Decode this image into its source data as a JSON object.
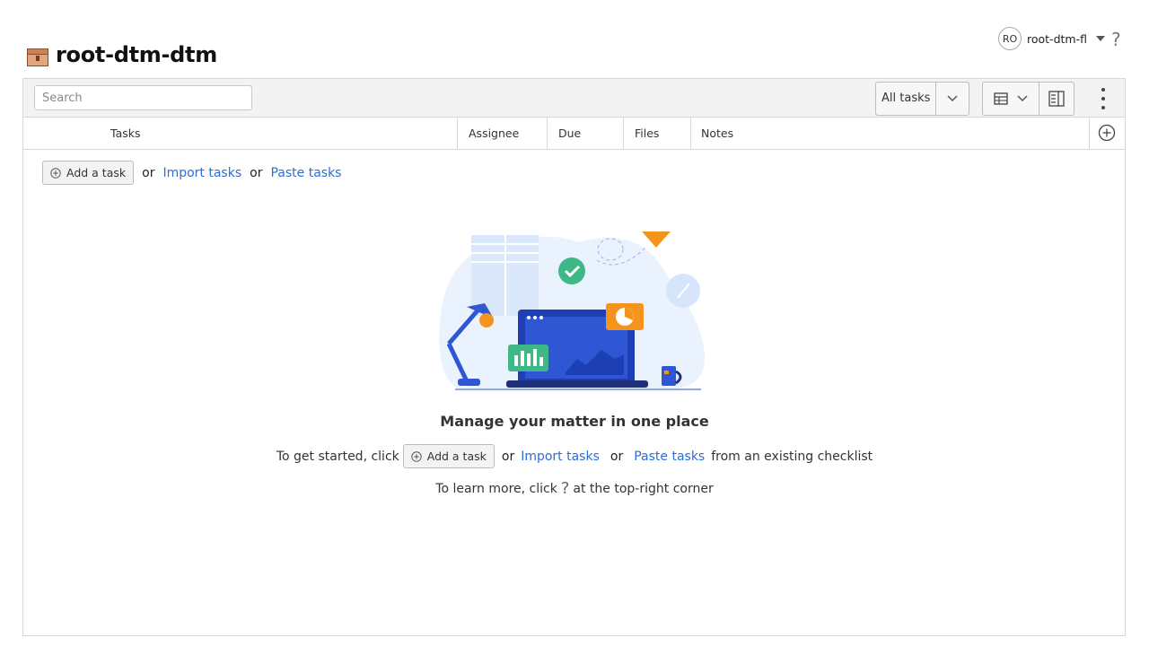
{
  "header": {
    "title": "root-dtm-dtm",
    "user_initials": "RO",
    "user_name": "root-dtm-fl",
    "help_glyph": "?"
  },
  "toolbar": {
    "search_placeholder": "Search",
    "filter_label": "All tasks"
  },
  "columns": [
    "Tasks",
    "Assignee",
    "Due",
    "Files",
    "Notes"
  ],
  "actions": {
    "add_task": "Add a task",
    "or": "or",
    "import_tasks": "Import tasks",
    "paste_tasks": "Paste tasks"
  },
  "empty_state": {
    "heading": "Manage your matter in one place",
    "line_prefix": "To get started, click",
    "line_suffix": "from an existing checklist",
    "learn_prefix": "To learn more, click",
    "learn_suffix": "at the top-right corner"
  },
  "colors": {
    "link": "#2c6dd6",
    "accent_blue": "#2f56d3",
    "accent_orange": "#f5941d",
    "accent_green": "#3fb887"
  },
  "icons": [
    "matter-icon",
    "chevron-down-icon",
    "table-view-icon",
    "split-view-icon",
    "kebab-menu-icon",
    "add-column-icon",
    "add-circle-icon",
    "help-icon"
  ]
}
